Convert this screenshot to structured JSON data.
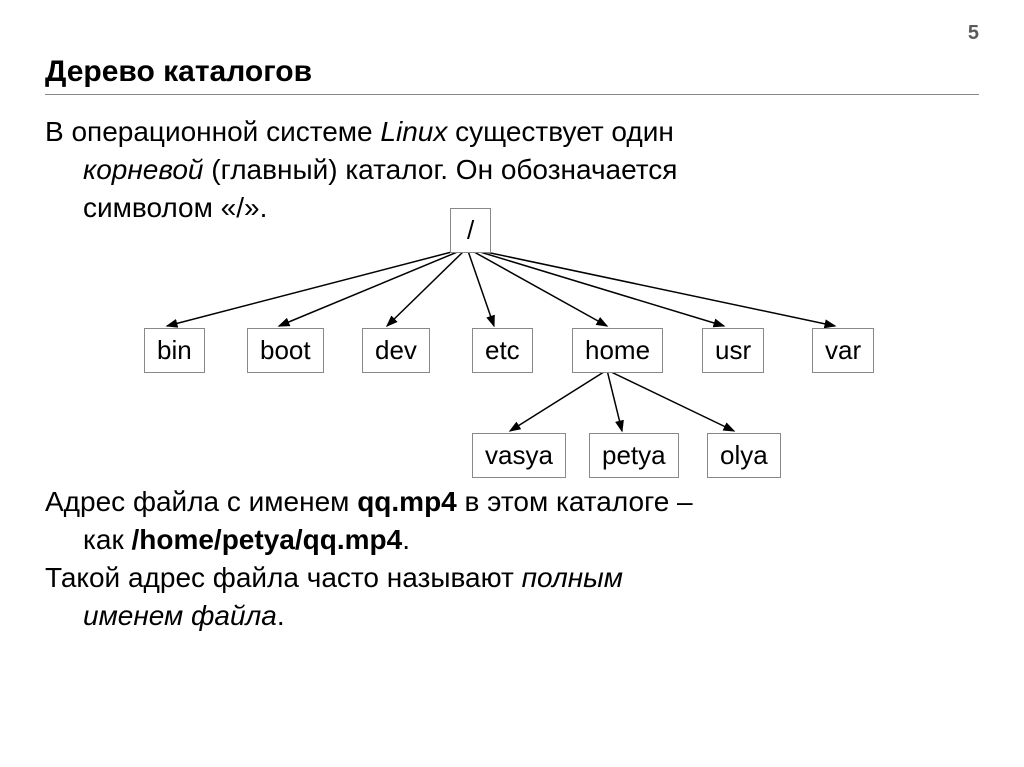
{
  "page_number": "5",
  "title": "Дерево каталогов",
  "paragraph1": {
    "t1": "В операционной системе ",
    "t2": "Linux",
    "t3": " существует один",
    "t4": "корневой",
    "t5": " (главный) каталог. Он обозначается",
    "t6": "символом «/»."
  },
  "paragraph2": {
    "t1": "Адрес файла с именем ",
    "t2": "qq.mp4",
    "t3": " в этом каталоге –",
    "t4": "как ",
    "t5": "/home/petya/qq.mp4",
    "t6": "."
  },
  "paragraph3": {
    "t1": "Такой адрес файла часто называют ",
    "t2": "полным",
    "t3": "именем файла",
    "t4": "."
  },
  "tree": {
    "root": "/",
    "level1": [
      "bin",
      "boot",
      "dev",
      "etc",
      "home",
      "usr",
      "var"
    ],
    "level2_parent": "home",
    "level2": [
      "vasya",
      "petya",
      "olya"
    ]
  }
}
